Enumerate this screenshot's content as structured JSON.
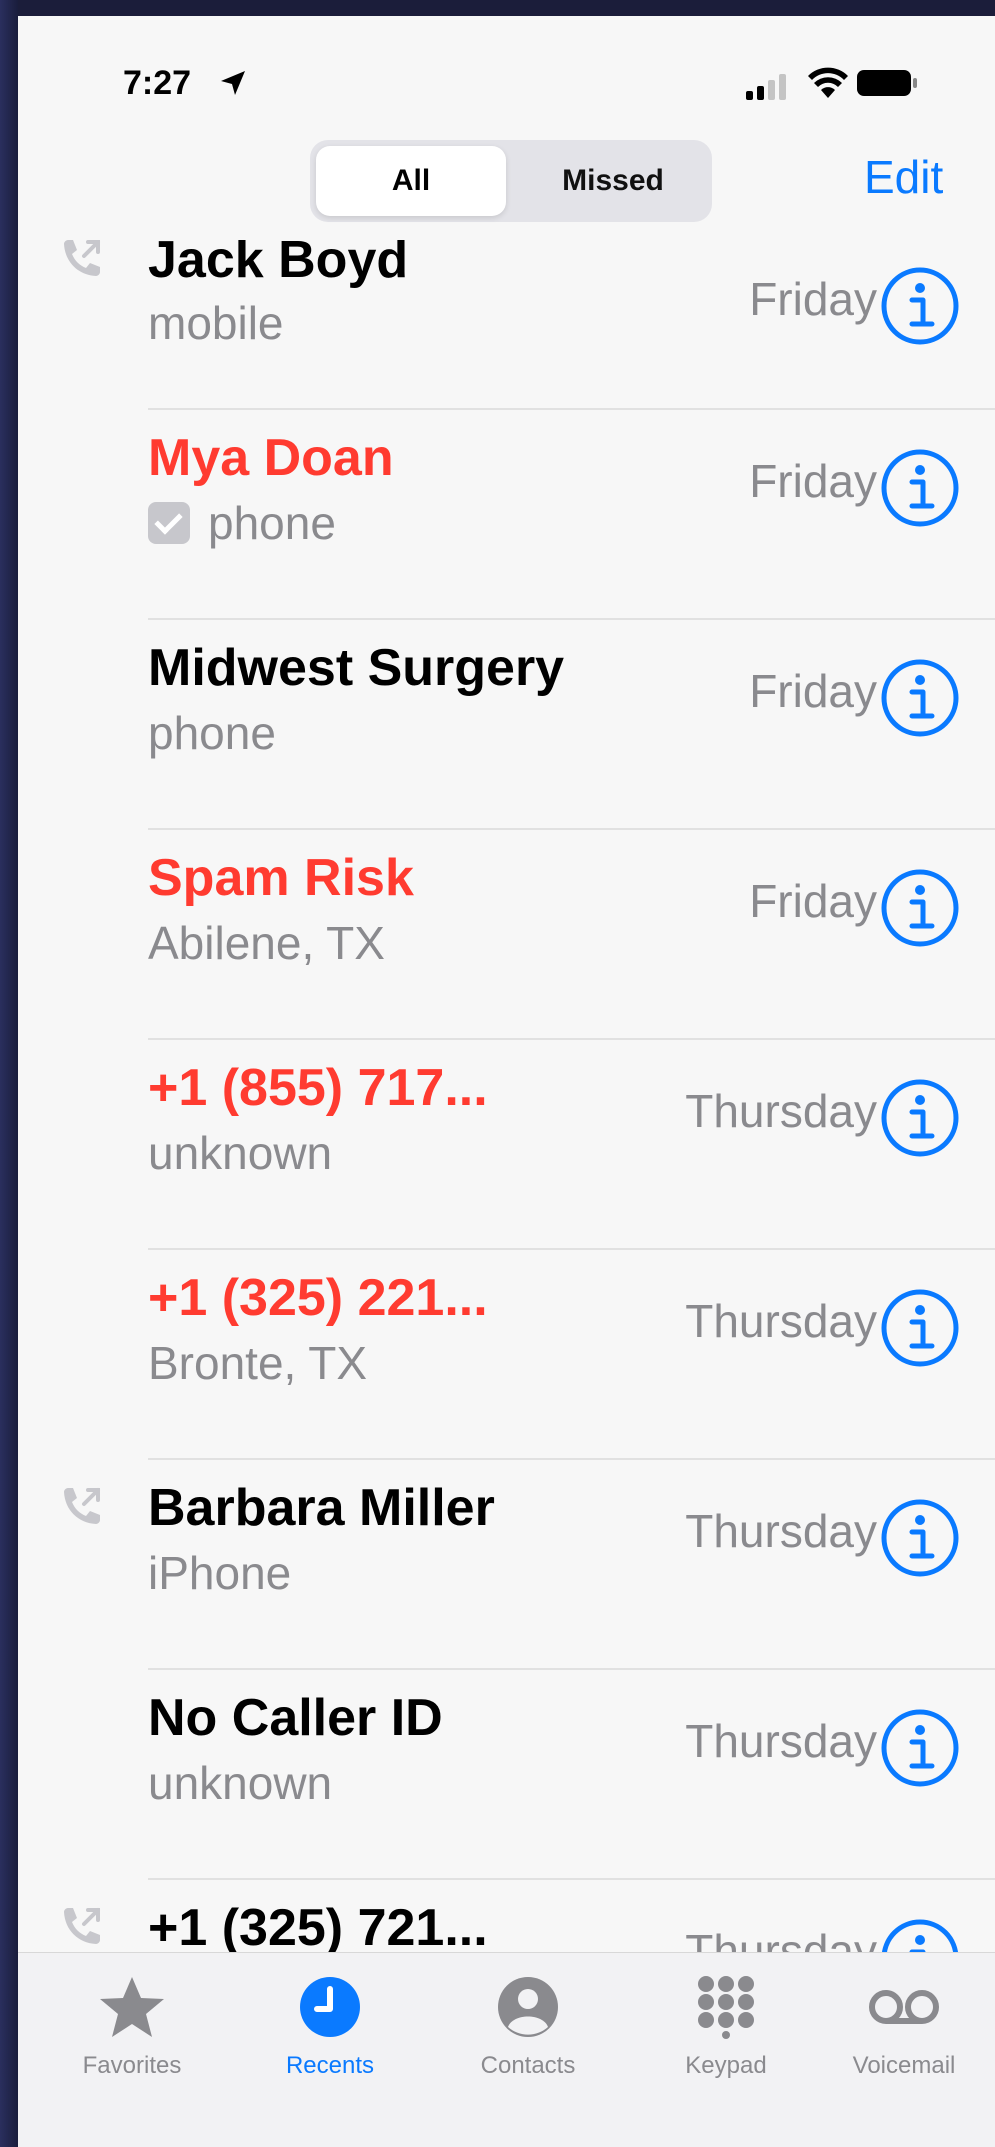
{
  "status": {
    "time": "7:27"
  },
  "header": {
    "segments": [
      "All",
      "Missed"
    ],
    "selected_segment": "All",
    "edit_label": "Edit"
  },
  "calls": [
    {
      "name": "Jack Boyd",
      "detail": "mobile",
      "day": "Friday",
      "missed": false,
      "outgoing": true,
      "verified": false
    },
    {
      "name": "Mya Doan",
      "detail": "phone",
      "day": "Friday",
      "missed": true,
      "outgoing": false,
      "verified": true
    },
    {
      "name": "Midwest Surgery",
      "detail": "phone",
      "day": "Friday",
      "missed": false,
      "outgoing": false,
      "verified": false
    },
    {
      "name": "Spam Risk",
      "detail": "Abilene, TX",
      "day": "Friday",
      "missed": true,
      "outgoing": false,
      "verified": false
    },
    {
      "name": "+1 (855) 717...",
      "detail": "unknown",
      "day": "Thursday",
      "missed": true,
      "outgoing": false,
      "verified": false
    },
    {
      "name": "+1 (325) 221...",
      "detail": "Bronte, TX",
      "day": "Thursday",
      "missed": true,
      "outgoing": false,
      "verified": false
    },
    {
      "name": "Barbara Miller",
      "detail": "iPhone",
      "day": "Thursday",
      "missed": false,
      "outgoing": true,
      "verified": false
    },
    {
      "name": "No Caller ID",
      "detail": "unknown",
      "day": "Thursday",
      "missed": false,
      "outgoing": false,
      "verified": false
    },
    {
      "name": "+1 (325) 721...",
      "detail": "",
      "day": "Thursday",
      "missed": false,
      "outgoing": true,
      "verified": false
    }
  ],
  "tabbar": {
    "tabs": [
      {
        "label": "Favorites",
        "icon": "star-icon",
        "active": false
      },
      {
        "label": "Recents",
        "icon": "clock-icon",
        "active": true
      },
      {
        "label": "Contacts",
        "icon": "person-circle-icon",
        "active": false
      },
      {
        "label": "Keypad",
        "icon": "keypad-icon",
        "active": false
      },
      {
        "label": "Voicemail",
        "icon": "voicemail-icon",
        "active": false
      }
    ]
  },
  "colors": {
    "accent": "#0a7aff",
    "missed": "#ff3b30",
    "secondary": "#8a8a8e"
  }
}
